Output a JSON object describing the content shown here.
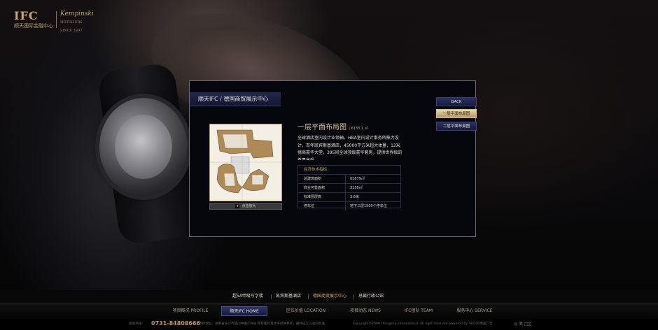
{
  "brand": {
    "ifc_logo": "IFC",
    "ifc_sub": "顺天国际金融中心",
    "kempinski": "Kempinski",
    "kempinski_sub": "HOTELIERS SINCE 1897"
  },
  "panel": {
    "header_title": "顺天IFC / 德国商贸展示中心",
    "floor_title": "一层平面布局图",
    "floor_area": "| 6133.1 ㎡",
    "zoom_label": "点击放大",
    "description": "全球酒店室内设计业领袖，HBA室内设计事务所鼎力设计，百年凯宾斯基酒店，45000平方米超大体量，12米挑高豪华大堂，395间全球顶级豪华套房，提供世界级的尊贵享受。",
    "tech_title": "经济技术指标",
    "tech_rows": [
      {
        "k": "总建筑面积",
        "v": "61879㎡"
      },
      {
        "k": "商业可售面积",
        "v": "3150㎡"
      },
      {
        "k": "标准层层高",
        "v": "3.6米"
      },
      {
        "k": "停车位",
        "v": "地下三层1500个停车位"
      }
    ]
  },
  "side_buttons": {
    "back": "BACK",
    "floor1": "一层平面布局图",
    "floor2": "二层平面布局图"
  },
  "subnav": [
    "超5A甲级写字楼",
    "凯宾斯基酒店",
    "德国商贸展示中心",
    "总裁行政公馆"
  ],
  "mainnav": [
    "项目概况 PROFILE",
    "顺天IFC HOME",
    "区位价值 LOCATION",
    "项目动态 NEWS",
    "IFC团队 TEAM",
    "服务中心 SERVICE"
  ],
  "footer": {
    "hotline_label": "招商热线：",
    "phone": "0731-84808666",
    "address": "项目地址：湖南省长沙市韶山中路419号  所有图片及文字仅供参考，最终成交以合同为准",
    "copyright": "Copyright©2009 changsha international. All right reserved    powered by SEEDO南迪广告",
    "icons": "◎ 关 ▯▯▯"
  },
  "colors": {
    "gold": "#d4ad62",
    "navy": "#1e2450",
    "panel_bg": "#06060d"
  }
}
